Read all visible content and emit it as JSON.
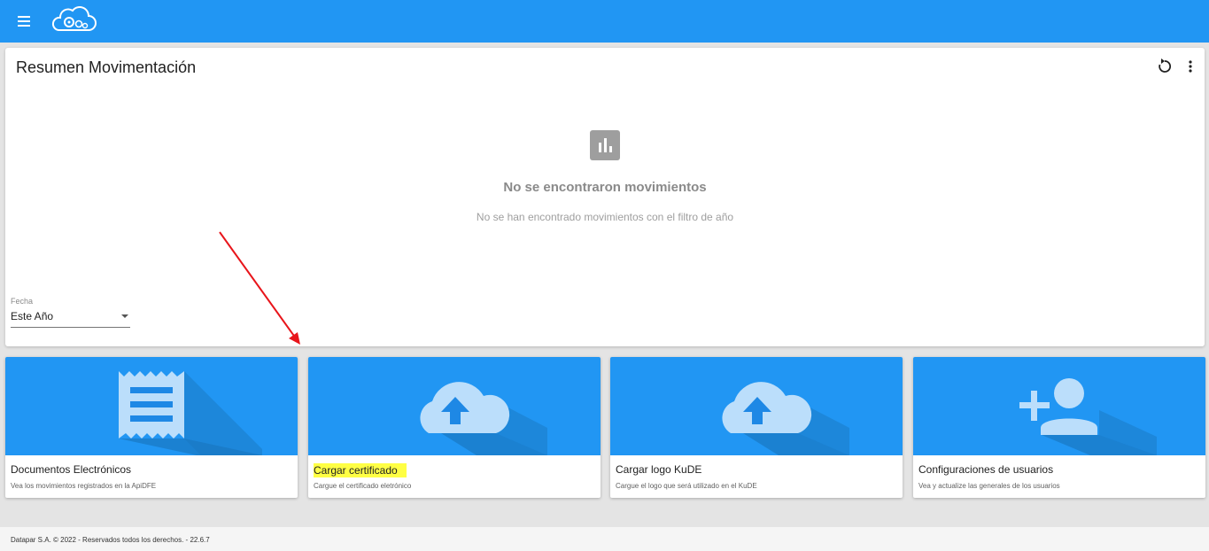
{
  "header": {
    "menu_icon": "hamburger-menu-icon",
    "logo_icon": "cloud-gears-logo",
    "brand_color": "#2196f3"
  },
  "summary": {
    "title": "Resumen Movimentación",
    "refresh_icon": "refresh-icon",
    "more_icon": "more-vertical-icon",
    "empty_icon": "bar-chart-icon",
    "empty_title": "No se encontraron movimientos",
    "empty_subtitle": "No se han encontrado movimientos con el filtro de año",
    "date_filter": {
      "label": "Fecha",
      "value": "Este Año"
    }
  },
  "tiles": [
    {
      "title": "Documentos Electrónicos",
      "description": "Vea los movimientos registrados en la ApiDFE",
      "icon": "receipt-icon"
    },
    {
      "title": "Cargar certificado",
      "description": "Cargue el certificado eletrónico",
      "icon": "cloud-upload-icon",
      "highlighted": true
    },
    {
      "title": "Cargar logo KuDE",
      "description": "Cargue el logo que será utilizado en el KuDE",
      "icon": "cloud-upload-icon"
    },
    {
      "title": "Configuraciones de usuarios",
      "description": "Vea y actualize las generales de los usuarios",
      "icon": "person-add-icon"
    }
  ],
  "annotation": {
    "arrow_color": "#e8151b"
  },
  "footer": {
    "text": "Datapar S.A. © 2022 - Reservados todos los derechos. - 22.6.7"
  }
}
